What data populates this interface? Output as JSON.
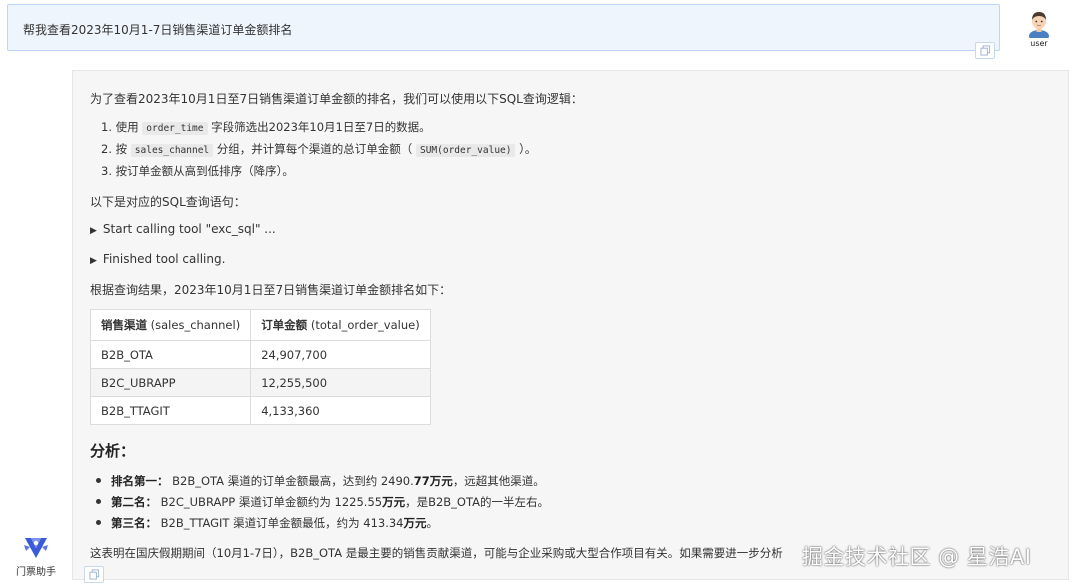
{
  "user_message": {
    "text": "帮我查看2023年10月1-7日销售渠道订单金额排名",
    "avatar_label": "user"
  },
  "assistant": {
    "name": "门票助手",
    "intro": "为了查看2023年10月1日至7日销售渠道订单金额的排名，我们可以使用以下SQL查询逻辑：",
    "steps": [
      {
        "num": "1.",
        "pre": "使用 ",
        "code": "order_time",
        "post": " 字段筛选出2023年10月1日至7日的数据。"
      },
      {
        "num": "2.",
        "pre": "按 ",
        "code": "sales_channel",
        "mid": " 分组，并计算每个渠道的总订单金额（ ",
        "code2": "SUM(order_value)",
        "post": " ）。"
      },
      {
        "num": "3.",
        "pre": "按订单金额从高到低排序（降序）。"
      }
    ],
    "sql_intro": "以下是对应的SQL查询语句：",
    "tool_start": "Start calling tool \"exc_sql\" ...",
    "tool_end": "Finished tool calling.",
    "result_intro": "根据查询结果，2023年10月1日至7日销售渠道订单金额排名如下：",
    "table": {
      "headers": [
        {
          "bold": "销售渠道",
          "rest": " (sales_channel)"
        },
        {
          "bold": "订单金额",
          "rest": " (total_order_value)"
        }
      ],
      "rows": [
        [
          "B2B_OTA",
          "24,907,700"
        ],
        [
          "B2C_UBRAPP",
          "12,255,500"
        ],
        [
          "B2B_TTAGIT",
          "4,133,360"
        ]
      ]
    },
    "analysis_title": "分析：",
    "analysis": [
      {
        "label": "排名第一：",
        "text1": " B2B_OTA 渠道的订单金额最高，达到约 2490.",
        "bold": "77万元",
        "text2": "，远超其他渠道。"
      },
      {
        "label": "第二名：",
        "text1": " B2C_UBRAPP 渠道订单金额约为 1225.55",
        "bold": "万元",
        "text2": "，是B2B_OTA的一半左右。"
      },
      {
        "label": "第三名：",
        "text1": " B2B_TTAGIT 渠道订单金额最低，约为 413.34",
        "bold": "万元",
        "text2": "。"
      }
    ],
    "conclusion": "这表明在国庆假期期间（10月1-7日），B2B_OTA 是最主要的销售贡献渠道，可能与企业采购或大型合作项目有关。如果需要进一步分析"
  },
  "watermark": "掘金技术社区 @ 星浩AI",
  "colors": {
    "user_bubble_bg": "#eef5fd",
    "user_bubble_border": "#bcd6f3",
    "panel_bg": "#f6f6f6",
    "logo_blue": "#3a5bd9"
  }
}
